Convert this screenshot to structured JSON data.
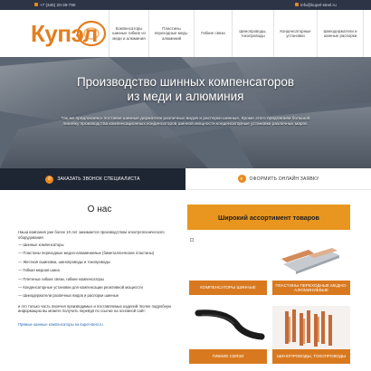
{
  "topbar": {
    "phone": "+7 (345) 20-39-790",
    "email": "info@kupel-steel.ru"
  },
  "logo": {
    "text": "Купэл"
  },
  "nav": {
    "items": [
      {
        "label": "Компенсаторы шинные гибкие из меди и алюминия"
      },
      {
        "label": "Пластины переходные медь-алюминий"
      },
      {
        "label": "Гибкие связи"
      },
      {
        "label": "Шинопроводы, токопроводы"
      },
      {
        "label": "Конденсаторные установки"
      },
      {
        "label": "Шинодержатели и шинные распорки"
      }
    ]
  },
  "hero": {
    "title_line1": "Производство шинных компенсаторов",
    "title_line2": "из меди и алюминия",
    "subtitle": "Так же предлагаем к поставке шинные держатели различных видов и распорки шинные. Кроме этого предлагаем большой линейку производства компенсационных конденсаторов шинной мощности конденсаторные установки различных марок."
  },
  "cta": {
    "callback": "ЗАКАЗАТЬ ЗВОНОК СПЕЦИАЛИСТА",
    "order": "ОФОРМИТЬ ОНЛАЙН ЗАЯВКУ"
  },
  "about": {
    "title": "О нас",
    "intro": "Наша компания уже более 10 лет занимается производством электротехнического оборудования:",
    "items": [
      "— Шинные компенсаторы",
      "— Пластины переходные медно-алюминиевые (биметаллические пластины)",
      "— Жесткая ошиновка, шинопроводы и токопроводы",
      "— Гибкая медная шина",
      "— Плетеные гибкие связи, гибкие компенсаторы",
      "— Конденсаторные установки для компенсации реактивной мощности",
      "— Шинодержатели различных видов и распорки шинные"
    ],
    "para2": "и это только часть перечня производимых и поставляемых изделий. Более подробную информацию вы можете получить перейдя по ссылке на основной сайт:",
    "link": "Прямые шинные компенсаторы на kupel-steel.ru"
  },
  "assortment": {
    "title": "Широкий ассортимент товаров",
    "cards": [
      {
        "caption": "КОМПЕНСАТОРЫ ШИННЫЕ",
        "image": "busbar-compensators"
      },
      {
        "caption": "ПЛАСТИНЫ ПЕРЕХОДНЫЕ МЕДНО-АЛЮМИНИЕВЫЕ",
        "image": "transition-plates"
      },
      {
        "caption": "ГИБКИЕ СВЯЗИ",
        "image": "flexible-links"
      },
      {
        "caption": "ШИНОПРОВОДЫ, ТОКОПРОВОДЫ",
        "image": "busways"
      }
    ]
  },
  "colors": {
    "accent": "#e8961f",
    "caption_bg": "#d9791f",
    "dark": "#1f2633"
  }
}
